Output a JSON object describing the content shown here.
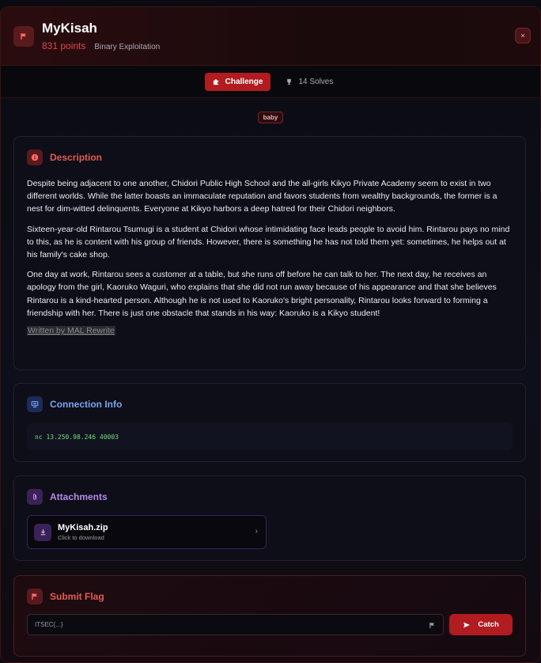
{
  "header": {
    "title": "MyKisah",
    "points": "831 points",
    "category": "Binary Exploitation",
    "close_label": "×"
  },
  "tabs": [
    {
      "label": "Challenge",
      "active": true,
      "icon": "puzzle-icon"
    },
    {
      "label": "14 Solves",
      "active": false,
      "icon": "trophy-icon"
    }
  ],
  "tag": "baby",
  "description": {
    "title": "Description",
    "paragraphs": [
      "Despite being adjacent to one another, Chidori Public High School and the all-girls Kikyo Private Academy seem to exist in two different worlds. While the latter boasts an immaculate reputation and favors students from wealthy backgrounds, the former is a nest for dim-witted delinquents. Everyone at Kikyo harbors a deep hatred for their Chidori neighbors.",
      "Sixteen-year-old Rintarou Tsumugi is a student at Chidori whose intimidating face leads people to avoid him. Rintarou pays no mind to this, as he is content with his group of friends. However, there is something he has not told them yet: sometimes, he helps out at his family's cake shop.",
      "One day at work, Rintarou sees a customer at a table, but she runs off before he can talk to her. The next day, he receives an apology from the girl, Kaoruko Waguri, who explains that she did not run away because of his appearance and that she believes Rintarou is a kind-hearted person. Although he is not used to Kaoruko's bright personality, Rintarou looks forward to forming a friendship with her. There is just one obstacle that stands in his way: Kaoruko is a Kikyo student!"
    ],
    "footer": "Written by MAL Rewrite"
  },
  "connection": {
    "title": "Connection Info",
    "command": "nc 13.250.98.246 40003"
  },
  "attachments": {
    "title": "Attachments",
    "file_name": "MyKisah.zip",
    "file_hint": "Click to download"
  },
  "submit": {
    "title": "Submit Flag",
    "placeholder": "ITSEC{...}",
    "button_label": "Catch"
  },
  "colors": {
    "accent_red": "#b01c1f",
    "description_title": "#e35c55",
    "connection_title": "#7aa4f0",
    "attachments_title": "#b489ea",
    "submit_title": "#e35c55"
  }
}
